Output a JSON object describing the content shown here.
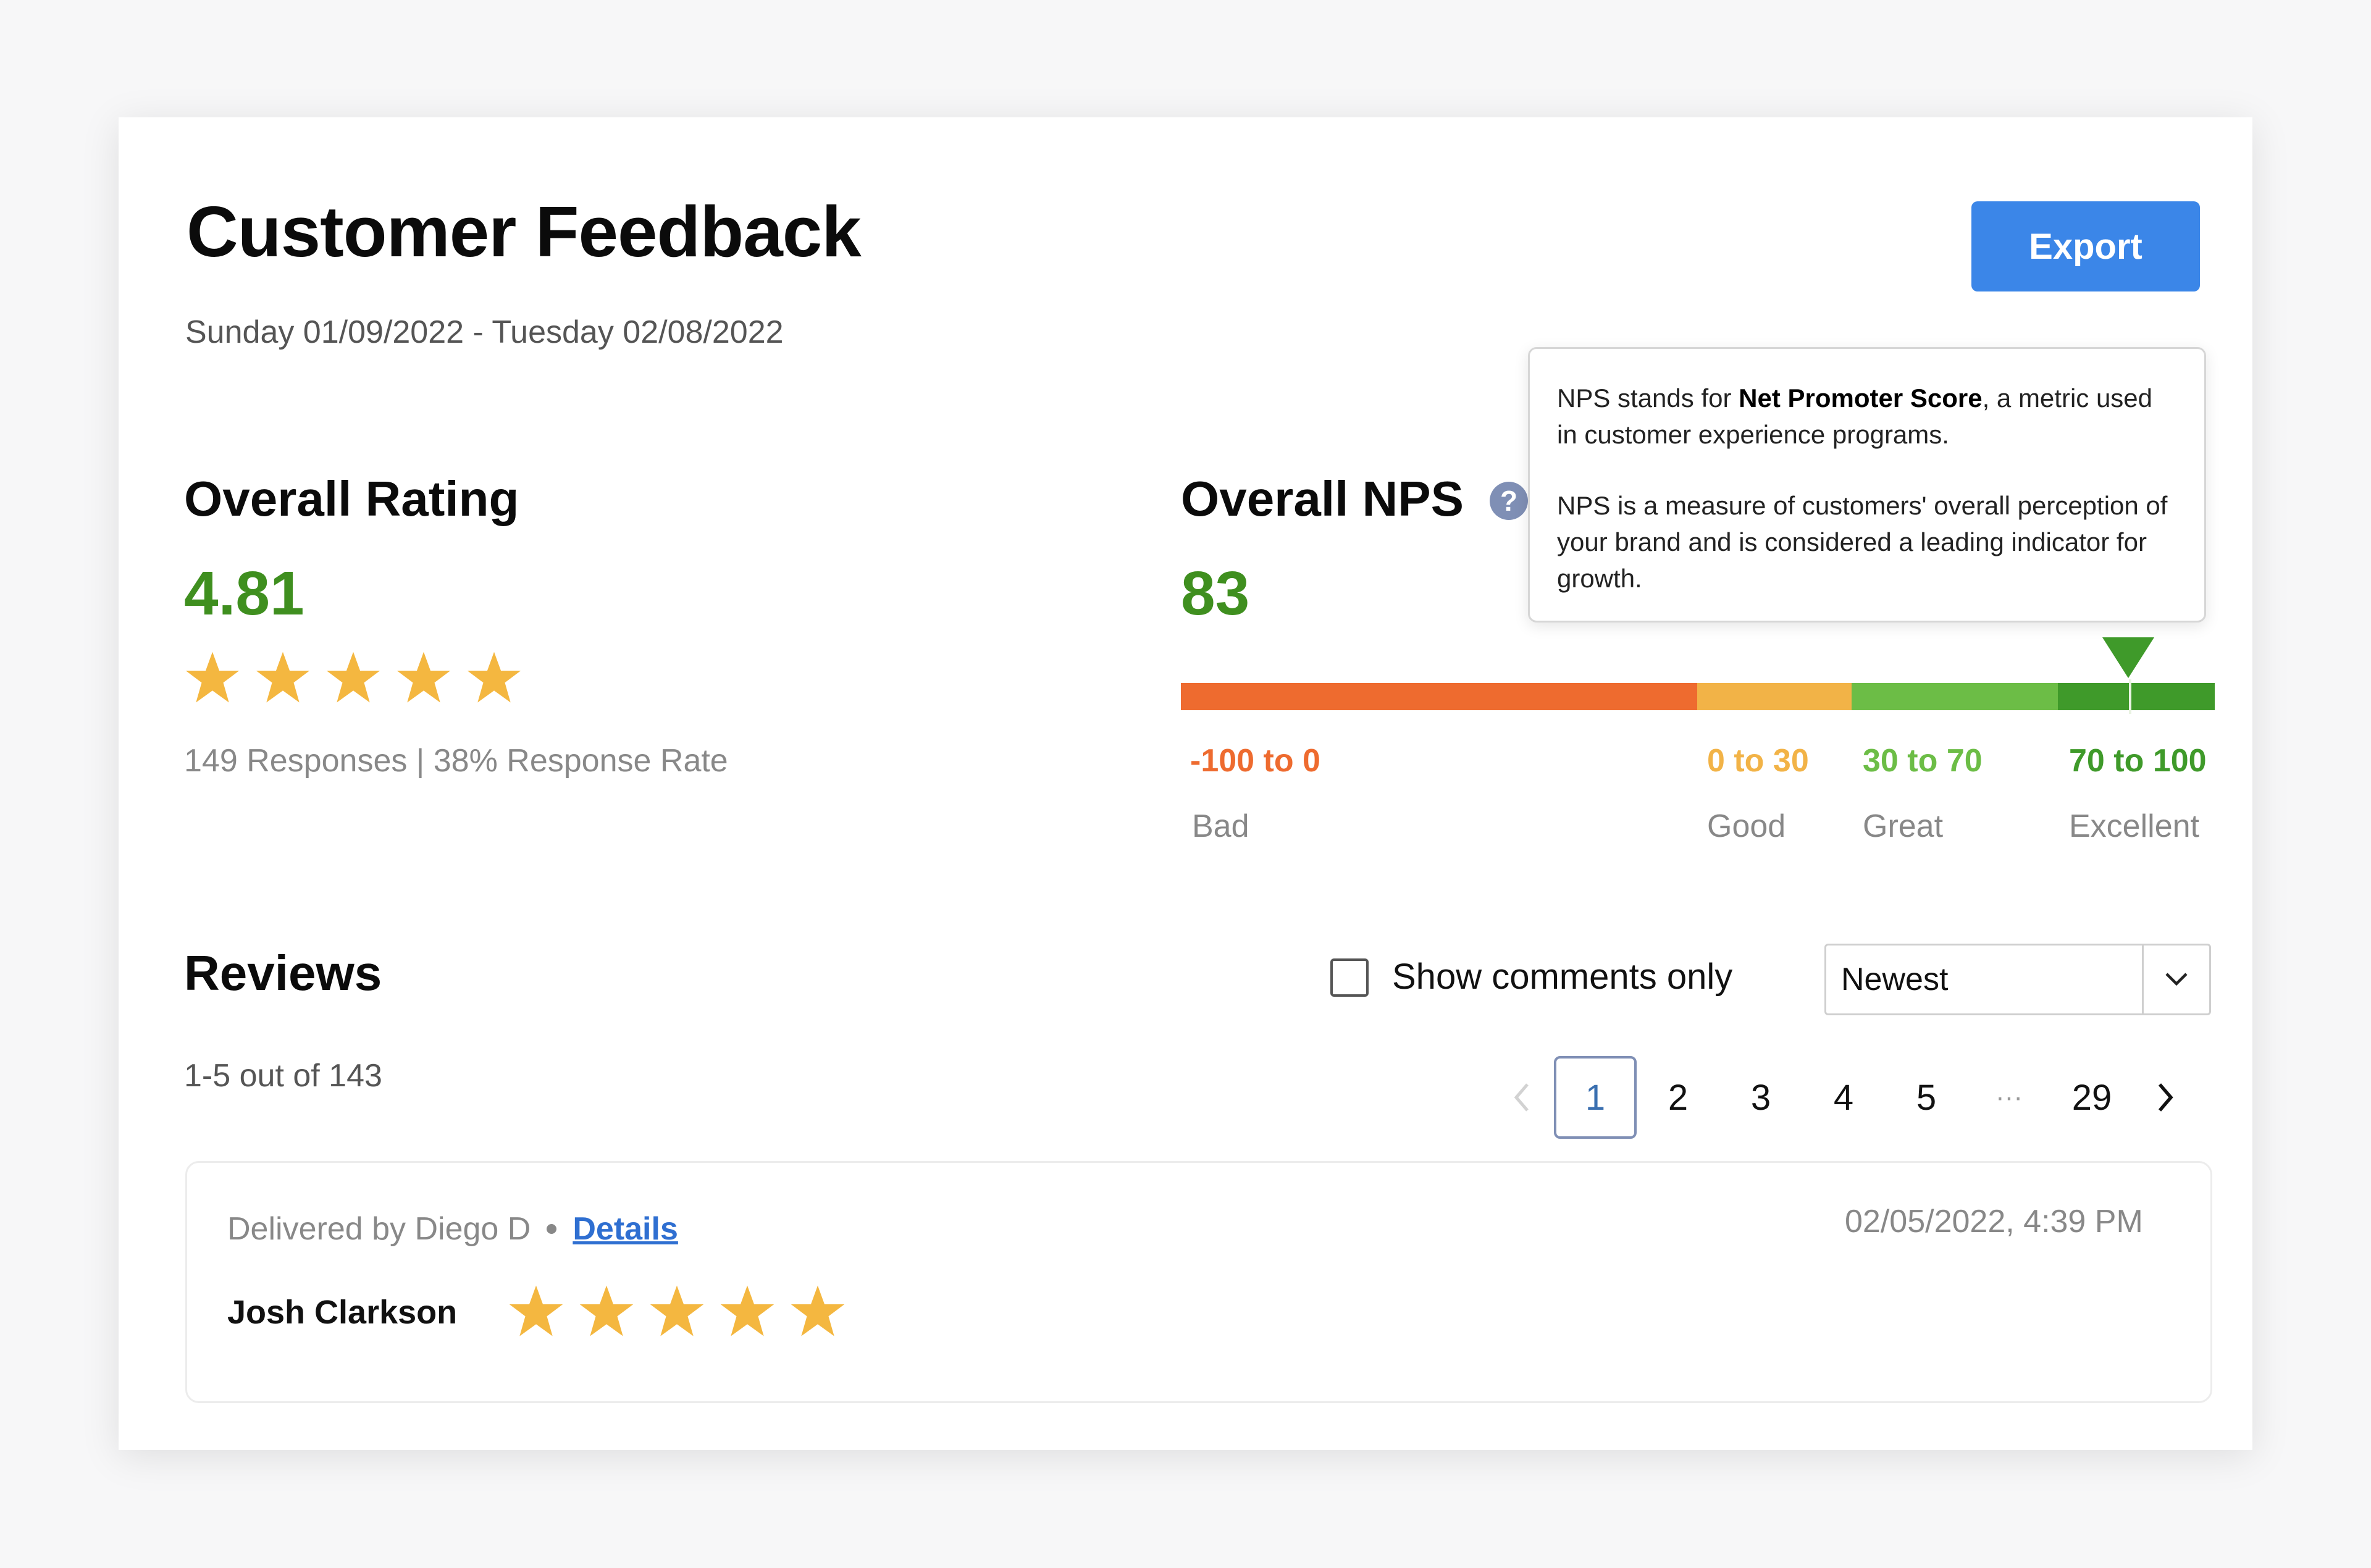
{
  "page": {
    "title": "Customer Feedback",
    "date_range": "Sunday 01/09/2022 - Tuesday 02/08/2022",
    "export_label": "Export",
    "accent_color": "#3b86e8"
  },
  "rating": {
    "title": "Overall Rating",
    "value": "4.81",
    "stars_filled": 5,
    "stars_total": 5,
    "responses_text": "149 Responses | 38% Response Rate"
  },
  "nps": {
    "title": "Overall NPS",
    "help_icon": "?",
    "value": "83",
    "score": 83,
    "ranges": [
      {
        "label": "-100 to 0",
        "tier": "Bad",
        "color": "#ee6b2f"
      },
      {
        "label": "0 to 30",
        "tier": "Good",
        "color": "#f2b347"
      },
      {
        "label": "30 to 70",
        "tier": "Great",
        "color": "#6cbd46"
      },
      {
        "label": "70 to 100",
        "tier": "Excellent",
        "color": "#3f9a2a"
      }
    ],
    "tooltip": {
      "line1_prefix": "NPS stands for ",
      "line1_bold": "Net Promoter Score",
      "line1_suffix": ", a metric used in customer experience programs.",
      "line2": "NPS is a measure of customers' overall perception of your brand and is considered a leading indicator for growth."
    }
  },
  "reviews": {
    "title": "Reviews",
    "count_text": "1-5 out of 143",
    "show_comments_label": "Show comments only",
    "show_comments_checked": false,
    "sort_value": "Newest",
    "pagination": {
      "current": "1",
      "pages": [
        "1",
        "2",
        "3",
        "4",
        "5"
      ],
      "ellipsis": "···",
      "last": "29"
    },
    "items": [
      {
        "delivered_by": "Delivered by Diego D",
        "details_label": "Details",
        "date": "02/05/2022, 4:39 PM",
        "name": "Josh Clarkson",
        "stars": 5
      }
    ]
  },
  "icons": {
    "star": "star-icon",
    "help": "question-icon",
    "caret": "chevron-down-icon",
    "prev": "chevron-left-icon",
    "next": "chevron-right-icon",
    "marker": "triangle-down-icon"
  },
  "colors": {
    "positive_green": "#3f8f1f",
    "star_gold": "#f4b740",
    "link_blue": "#2f6fd1"
  }
}
